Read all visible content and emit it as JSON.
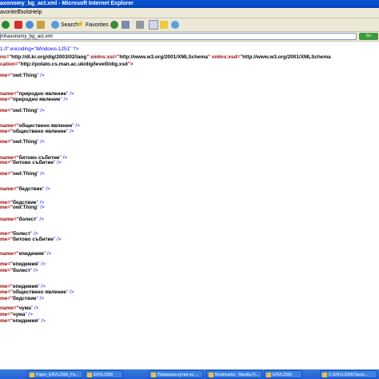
{
  "window": {
    "title": "axonomy_bg_act.xml - Microsoft Internet Explorer"
  },
  "menu": [
    "avorites",
    "Tools",
    "Help"
  ],
  "toolbar": {
    "search_label": "Search",
    "favorites_label": "Favorites"
  },
  "address": {
    "value": "ml\\axonomy_bg_act.xml",
    "go_label": "Go"
  },
  "xml": {
    "decl": {
      "a": "1.0\" encoding=\"Windows-1251\" ?>"
    },
    "ns1": {
      "a": "ns=\"",
      "b": "http://dl.kr.org/dig/2003/02/lang",
      "c": "\" xmlns:xsi=\"",
      "d": "http://www.w3.org/2001/XMLSchema",
      "e": "\" xmlns:xsd=\"",
      "f": "http://www.w3.org/2001/XMLSchema"
    },
    "ns2": {
      "a": "cation=\"",
      "b": "http://potato.cs.man.ac.uk/dig/level0/dig.xsd",
      "c": "\">"
    },
    "lines": [
      {
        "p": "me=\"",
        "v": "owl:Thing",
        "s": "\" />"
      },
      {
        "p": "name=\"",
        "v": "природно явление",
        "s": "\" />"
      },
      {
        "p": "me=\"",
        "v": "природно явление",
        "s": "\" />"
      },
      {
        "p": "me=\"",
        "v": "owl:Thing",
        "s": "\" />"
      },
      {
        "p": "name=\"",
        "v": "обществено явление",
        "s": "\" />"
      },
      {
        "p": "me=\"",
        "v": "обществено явление",
        "s": "\" />"
      },
      {
        "p": "me=\"",
        "v": "owl:Thing",
        "s": "\" />"
      },
      {
        "p": "name=\"",
        "v": "битово събитие",
        "s": "\" />"
      },
      {
        "p": "me=\"",
        "v": "битово събитие",
        "s": "\" />"
      },
      {
        "p": "me=\"",
        "v": "owl:Thing",
        "s": "\" />"
      },
      {
        "p": "name=\"",
        "v": "бедствие",
        "s": "\" />"
      },
      {
        "p": "me=\"",
        "v": "бедствие",
        "s": "\" />"
      },
      {
        "p": "me=\"",
        "v": "owl:Thing",
        "s": "\" />"
      },
      {
        "p": "name=\"",
        "v": "болест",
        "s": "\" />"
      },
      {
        "p": "me=\"",
        "v": "болест",
        "s": "\" />"
      },
      {
        "p": "me=\"",
        "v": "битово събитие",
        "s": "\" />"
      },
      {
        "p": "name=\"",
        "v": "епидемия",
        "s": "\" />"
      },
      {
        "p": "me=\"",
        "v": "епидемия",
        "s": "\" />"
      },
      {
        "p": "me=\"",
        "v": "болест",
        "s": "\" />"
      },
      {
        "p": "me=\"",
        "v": "епидемия",
        "s": "\" />"
      },
      {
        "p": "me=\"",
        "v": "обществено явление",
        "s": "\" />"
      },
      {
        "p": "me=\"",
        "v": "бедствие",
        "s": "\" />"
      },
      {
        "p": "name=\"",
        "v": "чума",
        "s": "\" />"
      },
      {
        "p": "me=\"",
        "v": "чума",
        "s": "\" />"
      },
      {
        "p": "me=\"",
        "v": "епидемия",
        "s": "\" />"
      }
    ]
  },
  "taskbar": [
    "Paper_ERVL2006_Pa...",
    "ERVL2006",
    "Повишена кутия на ...",
    "Bookmarks - Mozilla Fi...",
    "ERVL2006",
    "C:\\ERVL2006\\Taxon..."
  ],
  "colors": {
    "title": "#0a52d6",
    "chrome": "#ece9d8",
    "taskbar": "#245edb"
  }
}
